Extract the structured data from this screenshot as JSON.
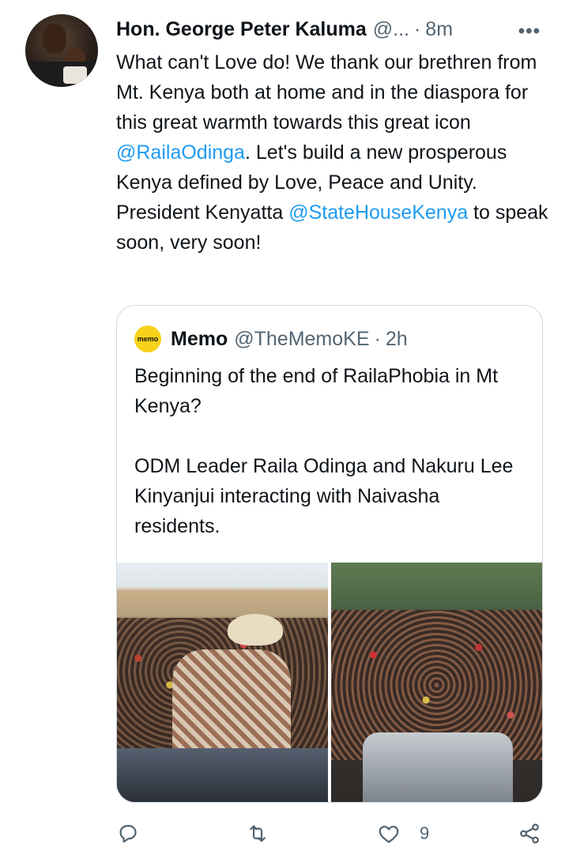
{
  "tweet": {
    "author_name": "Hon. George Peter Kaluma",
    "author_handle": "@...",
    "separator": "·",
    "time": "8m",
    "more": "•••",
    "text": {
      "line_a": "What can't Love do! We thank our brethren from Mt. Kenya both at home and in the diaspora for this great warmth towards this great icon ",
      "mention_1": "@RailaOdinga",
      "line_b": ". Let's build a new prosperous Kenya defined by Love, Peace and Unity.",
      "line_c": "President Kenyatta ",
      "mention_2": "@StateHouseKenya",
      "line_d": " to speak soon, very soon!"
    }
  },
  "quote": {
    "logo_text": "memo",
    "name": "Memo",
    "handle": "@TheMemoKE",
    "separator": "·",
    "time": "2h",
    "paragraph_1": "Beginning of the end of RailaPhobia in Mt Kenya?",
    "paragraph_2": "ODM Leader Raila Odinga and Nakuru Lee Kinyanjui interacting with Naivasha residents."
  },
  "actions": {
    "like_count": "9"
  },
  "colors": {
    "link": "#1d9bf0",
    "text": "#0f1419",
    "muted": "#536471",
    "border": "#cfd9de",
    "memo_logo": "#f7d21a"
  },
  "icons": [
    "more-icon",
    "reply-icon",
    "retweet-icon",
    "like-icon",
    "share-icon"
  ]
}
